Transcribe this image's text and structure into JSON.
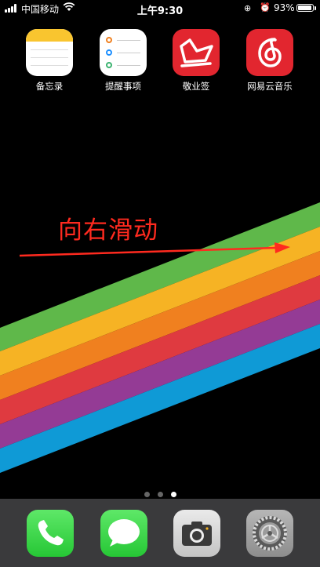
{
  "status_bar": {
    "carrier": "中国移动",
    "time": "上午9:30",
    "battery_percent": "93%",
    "battery_level": 0.93
  },
  "apps": [
    {
      "label": "备忘录",
      "icon": "notes-icon"
    },
    {
      "label": "提醒事项",
      "icon": "reminders-icon"
    },
    {
      "label": "敬业签",
      "icon": "jingyeqian-icon"
    },
    {
      "label": "网易云音乐",
      "icon": "netease-music-icon"
    }
  ],
  "annotation": {
    "text": "向右滑动",
    "color": "#ff2a1f"
  },
  "page_indicator": {
    "count": 3,
    "current": 3
  },
  "dock": [
    {
      "icon": "phone-icon"
    },
    {
      "icon": "messages-icon"
    },
    {
      "icon": "camera-icon"
    },
    {
      "icon": "settings-icon"
    }
  ],
  "colors": {
    "stripe_green": "#5fb84a",
    "stripe_yellow": "#f6b324",
    "stripe_orange": "#f0801f",
    "stripe_red": "#df3a40",
    "stripe_purple": "#943b95",
    "stripe_blue": "#0f9ad6"
  }
}
